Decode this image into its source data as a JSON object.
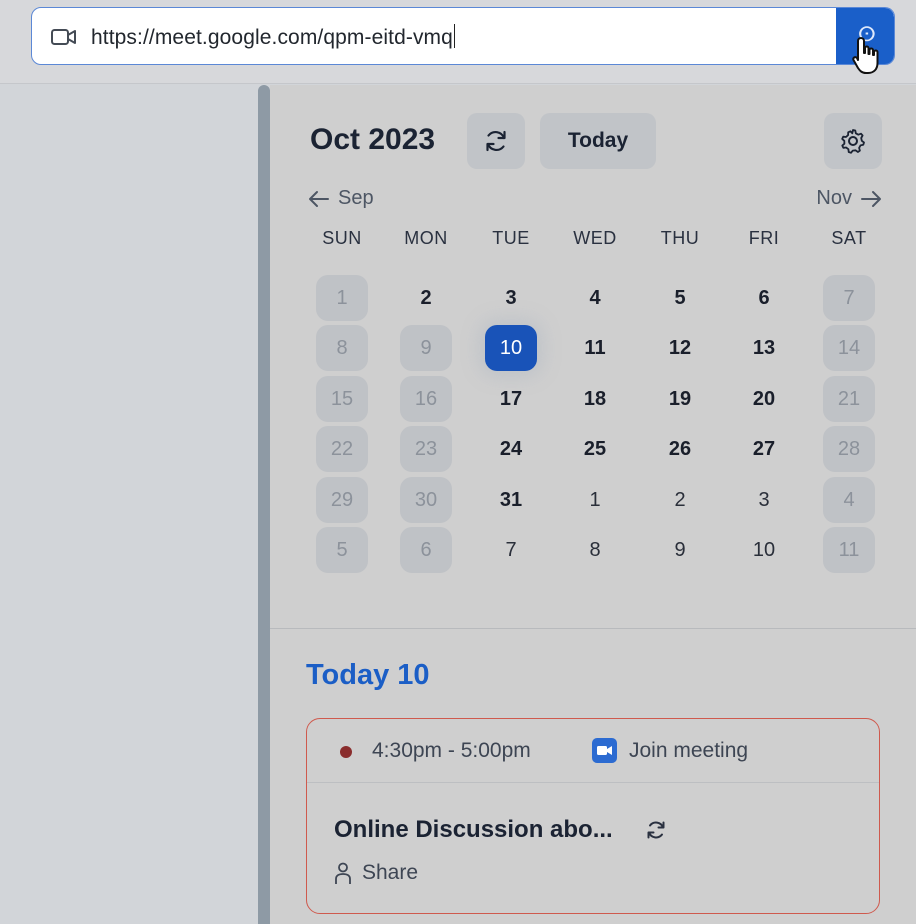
{
  "address_bar": {
    "url": "https://meet.google.com/qpm-eitd-vmq",
    "go_glyph": "ⵙ",
    "left_icon": "video-camera-icon",
    "cursor": "hand-pointer-icon"
  },
  "calendar": {
    "month_title": "Oct 2023",
    "today_button": "Today",
    "prev_month": "Sep",
    "next_month": "Nov",
    "weekdays": [
      "SUN",
      "MON",
      "TUE",
      "WED",
      "THU",
      "FRI",
      "SAT"
    ],
    "weeks": [
      [
        "1",
        "2",
        "3",
        "4",
        "5",
        "6",
        "7"
      ],
      [
        "8",
        "9",
        "10",
        "11",
        "12",
        "13",
        "14"
      ],
      [
        "15",
        "16",
        "17",
        "18",
        "19",
        "20",
        "21"
      ],
      [
        "22",
        "23",
        "24",
        "25",
        "26",
        "27",
        "28"
      ],
      [
        "29",
        "30",
        "31",
        "1",
        "2",
        "3",
        "4"
      ],
      [
        "5",
        "6",
        "7",
        "8",
        "9",
        "10",
        "11"
      ]
    ],
    "selected_day": "10"
  },
  "agenda": {
    "heading": "Today 10",
    "event": {
      "time": "4:30pm - 5:00pm",
      "join_label": "Join meeting",
      "title": "Online Discussion abo...",
      "share_label": "Share"
    }
  },
  "colors": {
    "accent": "#1953b8",
    "heading_blue": "#1b5ec6",
    "event_border": "#cf5a4e",
    "event_dot": "#8a2d2d"
  }
}
